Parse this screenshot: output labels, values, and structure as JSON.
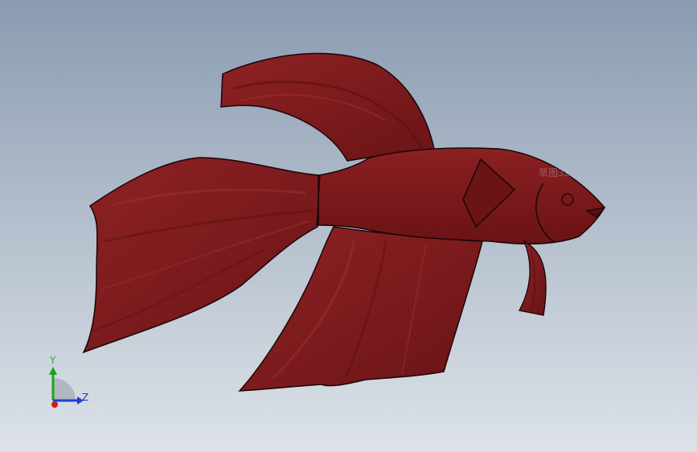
{
  "viewport": {
    "background_top": "#8a9bb1",
    "background_bottom": "#dde2e8"
  },
  "model": {
    "icon": "betta-fish-3d-model",
    "body_color": "#7e1a1c",
    "shade_color": "#5c0f12",
    "highlight_color": "#9a2a2c",
    "edge_color": "#1a0606",
    "ghost_label": "草图32"
  },
  "triad": {
    "y_label": "Y",
    "z_label": "Z",
    "y_color": "#1aa51a",
    "z_color": "#1f3fd6",
    "x_color": "#d11a1a",
    "label_y_color": "#2aa82a",
    "label_z_color": "#2437c8"
  }
}
